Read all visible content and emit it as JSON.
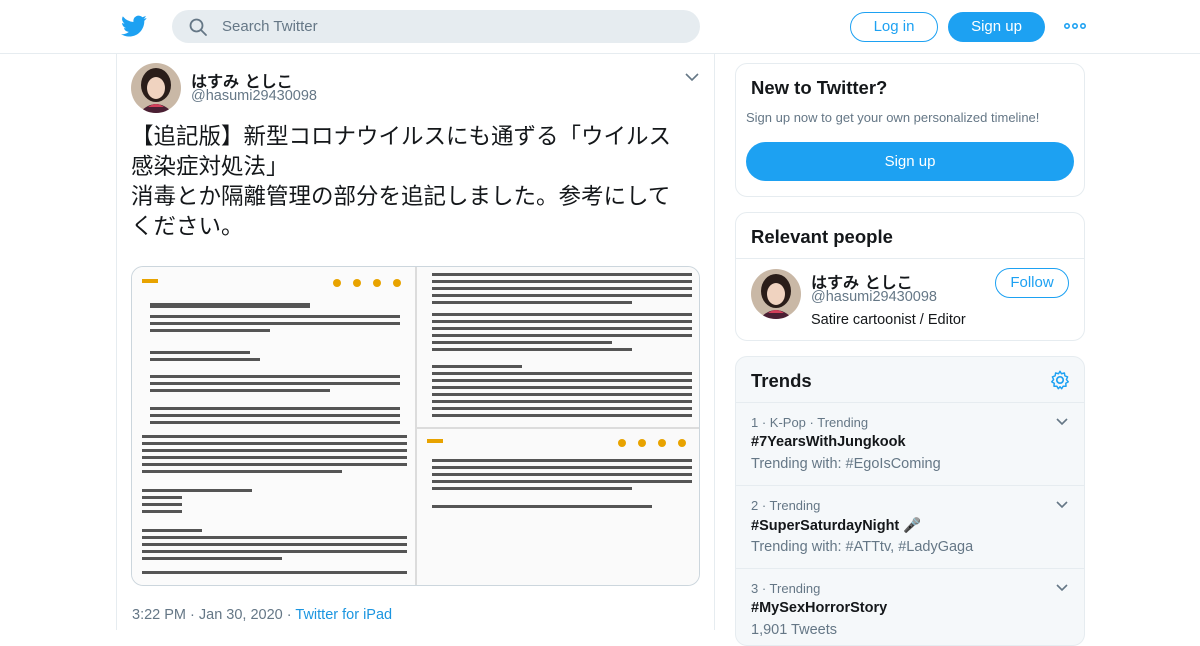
{
  "header": {
    "search_placeholder": "Search Twitter",
    "login_label": "Log in",
    "signup_label": "Sign up",
    "brand_color": "#1da1f2"
  },
  "tweet": {
    "display_name": "はすみ としこ",
    "handle": "@hasumi29430098",
    "text_lines": [
      "【追記版】新型コロナウイルスにも通ずる「ウイルス",
      "感染症対処法」",
      "消毒とか隔離管理の部分を追記しました。参考にして",
      "ください。"
    ],
    "time": "3:22 PM",
    "date": "Jan 30, 2020",
    "source": "Twitter for iPad"
  },
  "new_to_twitter": {
    "title": "New to Twitter?",
    "subtitle": "Sign up now to get your own personalized timeline!",
    "button_label": "Sign up"
  },
  "relevant_people": {
    "title": "Relevant people",
    "name": "はすみ としこ",
    "handle": "@hasumi29430098",
    "bio": "Satire cartoonist / Editor",
    "follow_label": "Follow"
  },
  "trends": {
    "title": "Trends",
    "items": [
      {
        "context": "1 · K-Pop · Trending",
        "name": "#7YearsWithJungkook",
        "sub": "Trending with: #EgoIsComing"
      },
      {
        "context": "2 · Trending",
        "name": "#SuperSaturdayNight 🎤",
        "sub": "Trending with: #ATTtv, #LadyGaga"
      },
      {
        "context": "3 · Trending",
        "name": "#MySexHorrorStory",
        "sub": "1,901 Tweets"
      }
    ]
  }
}
